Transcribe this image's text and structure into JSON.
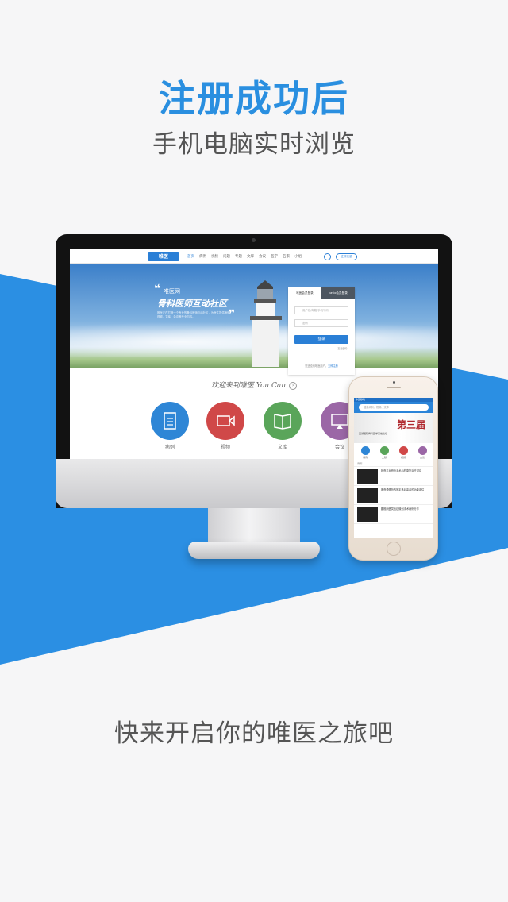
{
  "headline": "注册成功后",
  "subhead": "手机电脑实时浏览",
  "footer_text": "快来开启你的唯医之旅吧",
  "colors": {
    "accent": "#2a8fe0",
    "band": "#2b8fe3",
    "text": "#555555"
  },
  "website": {
    "logo": "唯医",
    "nav": [
      "首页",
      "病例",
      "视频",
      "问题",
      "专题",
      "文库",
      "会议",
      "医学",
      "名家",
      "小组"
    ],
    "app_button": "立即注册",
    "hero": {
      "small_title": "唯医网",
      "title": "骨科医师互动社区",
      "desc": "唯医正在打造一个专业的骨科医师互动社区，为医生提供病例、视频、文库、会议等专业内容。"
    },
    "login": {
      "tab_member": "唯医会员登录",
      "tab_other": "casio会员登录",
      "username_placeholder": "用户名/邮箱/手机号码",
      "password_placeholder": "密码",
      "login_button": "登录",
      "forgot": "忘记密码?",
      "footer_prefix": "您还没有唯医用户，",
      "footer_link": "立即注册"
    },
    "welcome": "欢迎来到唯医 You Can",
    "features": [
      {
        "label": "病例",
        "color": "#2e86d6",
        "icon": "clipboard-icon"
      },
      {
        "label": "视频",
        "color": "#d04848",
        "icon": "video-camera-icon"
      },
      {
        "label": "文库",
        "color": "#5aa55a",
        "icon": "book-icon"
      },
      {
        "label": "会议",
        "color": "#9b67a6",
        "icon": "presentation-icon"
      }
    ]
  },
  "phone": {
    "status": "中国移动",
    "search_placeholder": "搜索病例、视频、文章",
    "banner_title": "第三届",
    "banner_sub": "西湖国际骨科医学高峰论坛",
    "icons": [
      {
        "label": "病例",
        "color": "#2e86d6"
      },
      {
        "label": "文献",
        "color": "#5aa55a"
      },
      {
        "label": "视频",
        "color": "#d04848"
      },
      {
        "label": "会议",
        "color": "#9b67a6"
      }
    ],
    "section": "病例",
    "items": [
      "胫骨平台骨折手术后的康复治疗讨论",
      "股骨颈骨折内固定术后患者的功能评估",
      "腰椎间盘突出症微创手术病例分享"
    ]
  }
}
